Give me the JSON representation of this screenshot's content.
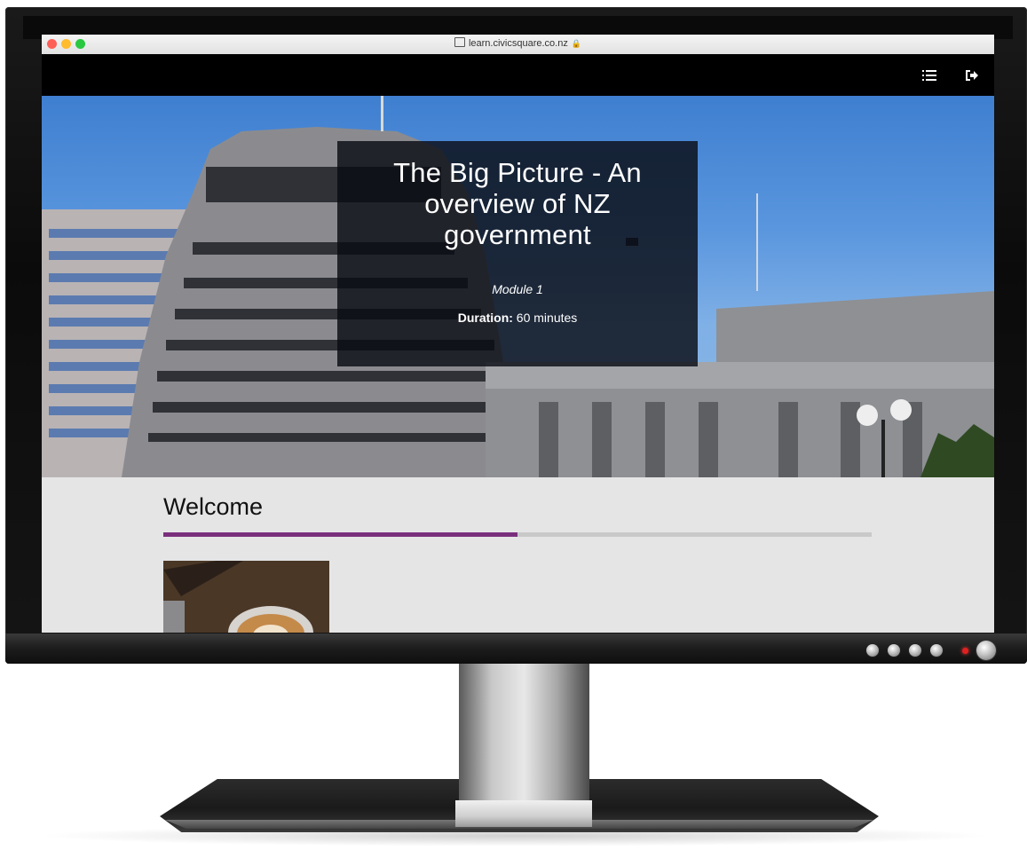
{
  "browser": {
    "url": "learn.civicsquare.co.nz",
    "traffic_lights": [
      "#fe5f57",
      "#febc2e",
      "#28c840"
    ]
  },
  "header": {
    "menu_icon": "list-icon",
    "logout_icon": "sign-out-icon"
  },
  "hero": {
    "title": "The Big Picture - An overview of NZ government",
    "module": "Module 1",
    "duration_label": "Duration:",
    "duration_value": " 60 minutes"
  },
  "section": {
    "heading": "Welcome",
    "progress_fraction": 0.5,
    "progress_color": "#7a2f7c"
  }
}
